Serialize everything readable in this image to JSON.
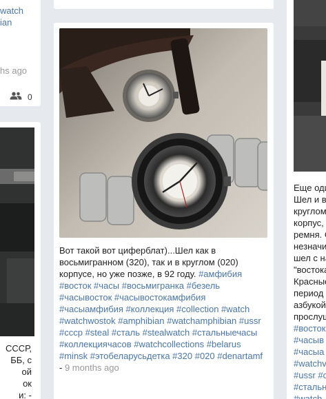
{
  "left_top": {
    "lines": [
      "watch",
      "ian"
    ],
    "time": "hs ago",
    "users_count": "0"
  },
  "left_bottom": {
    "lines": [
      "СССР,",
      "ББ, с",
      "ой",
      "ок",
      "и: -"
    ]
  },
  "mid_post": {
    "text_parts": [
      {
        "t": "Вот такой вот циферблат)...Шел как в восьмигранном (320), так и в круглом (020) корпусе, но уже позже, в 92 году. ",
        "tag": false
      },
      {
        "t": "#амфибия #восток #часы #восьмигранка #безель #часывосток #часывостокамфибия #часыамфибия #коллекция #collection #watch #watchwostok #amphibian #watchamphibian #ussr #ссср #steal #сталь #stealwatch #стальныечасы #коллекциячасов #watchcollections #belarus #minsk #этобеларусьдетка #320 #020 #denartamf",
        "tag": true
      },
      {
        "t": " - ",
        "tag": false
      },
      {
        "t": "9 months ago",
        "time": true
      }
    ]
  },
  "right_post": {
    "lines": [
      "Еще оди",
      "Шел и в",
      "круглом",
      "корпус,",
      "ремня. С",
      "незначи",
      "шел с на",
      "\"востока",
      "Красные",
      "период",
      "азбукой",
      "прослуш"
    ],
    "tags": [
      "#восток",
      "#часыв",
      "#часыа",
      "#watchv",
      "#ussr #с",
      "#стальн",
      "#watch"
    ]
  },
  "colors": {
    "link": "#4a76a8",
    "time": "#999999",
    "background": "#e6e9ee"
  }
}
